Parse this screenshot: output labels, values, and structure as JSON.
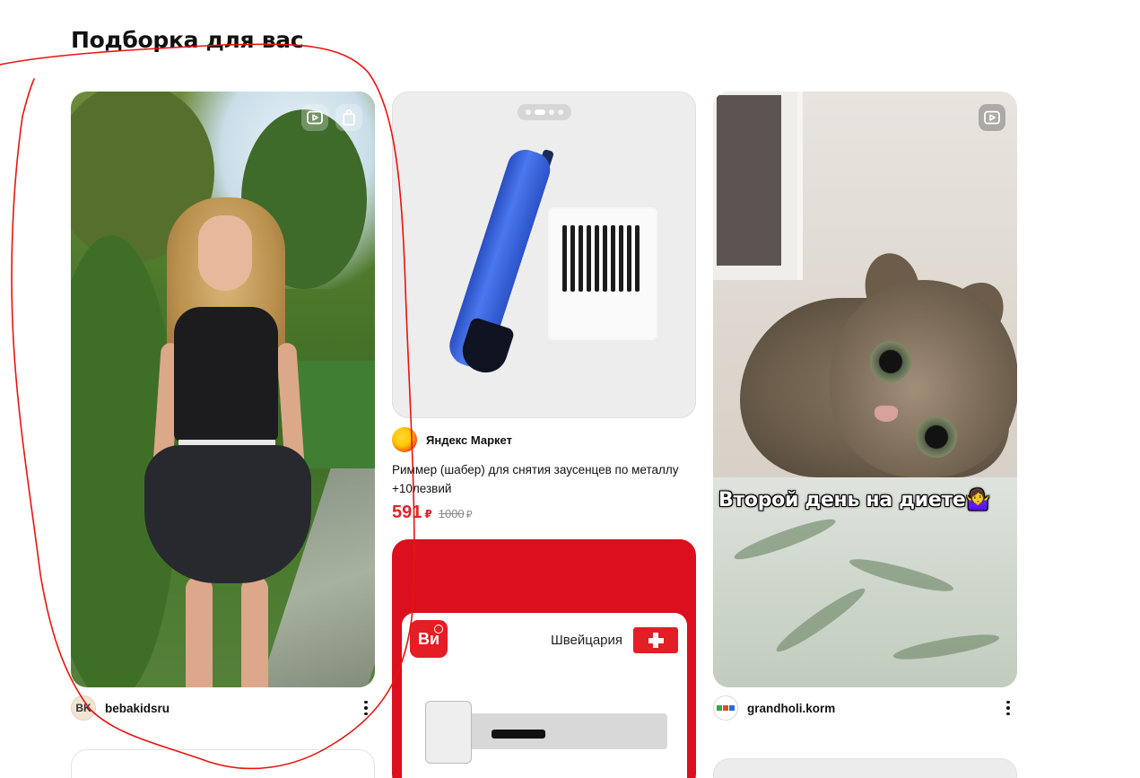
{
  "section": {
    "title": "Подборка для вас"
  },
  "cards": [
    {
      "kind": "video",
      "author": {
        "initials": "BK",
        "name": "bebakidsru",
        "avatar_color": "#f1e4d3"
      },
      "icons": [
        "video-icon",
        "shopping-bag-icon"
      ]
    },
    {
      "kind": "product",
      "carousel": {
        "total": 4,
        "active": 1
      },
      "source": {
        "name": "Яндекс Маркет"
      },
      "title": "Риммер (шабер) для снятия заусенцев по металлу +10лезвий",
      "price": {
        "current": "591",
        "currency": "₽",
        "old": "1000",
        "old_currency": "₽"
      },
      "accent": "#e3222c"
    },
    {
      "kind": "ad",
      "brand": {
        "logo_text": "Ви",
        "color": "#e31e24"
      },
      "country": "Швейцария"
    },
    {
      "kind": "video",
      "caption": "Второй день на диете🤷‍♀️",
      "author": {
        "name": "grandholi.korm"
      },
      "icons": [
        "video-icon"
      ]
    }
  ]
}
